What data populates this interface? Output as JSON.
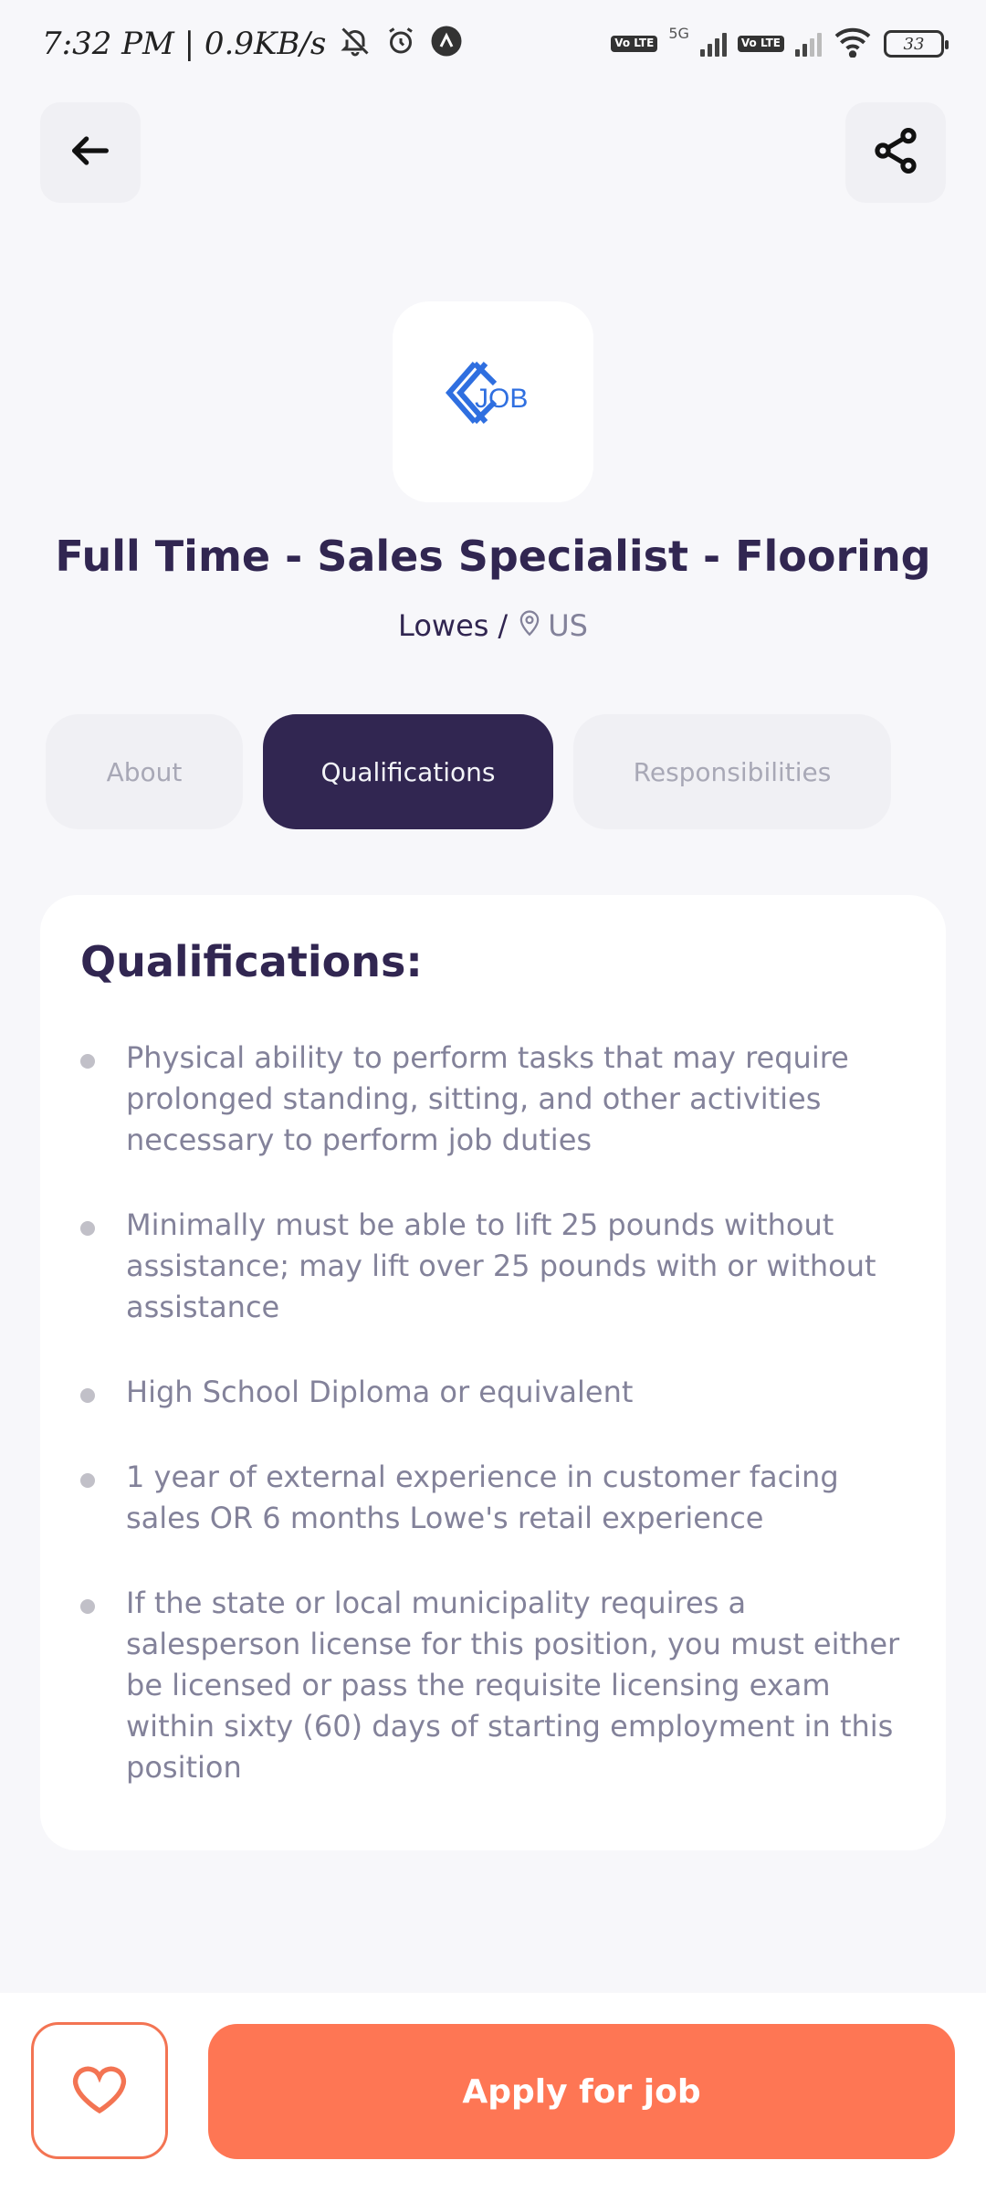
{
  "status_bar": {
    "time": "7:32 PM | 0.9KB/s",
    "volte_label": "Vo LTE",
    "network_label": "5G",
    "battery_level": "33"
  },
  "header": {
    "back_icon": "arrow-left-icon",
    "share_icon": "share-icon"
  },
  "job": {
    "logo_text": "JOB",
    "title": "Full Time - Sales Specialist - Flooring",
    "company": "Lowes",
    "separator": "/",
    "location": "US"
  },
  "tabs": [
    {
      "label": "About",
      "active": false
    },
    {
      "label": "Qualifications",
      "active": true
    },
    {
      "label": "Responsibilities",
      "active": false
    }
  ],
  "qualifications": {
    "heading": "Qualifications:",
    "items": [
      "Physical ability to perform tasks that may require prolonged standing, sitting, and other activities necessary to perform job duties",
      "Minimally must be able to lift 25 pounds without assistance; may lift over 25 pounds with or without assistance",
      "High School Diploma or equivalent",
      "1 year of external experience in customer facing sales OR 6 months Lowe's retail experience",
      "If the state or local municipality requires a salesperson license for this position, you must either be licensed or pass the requisite licensing exam within sixty (60) days of starting employment in this position"
    ]
  },
  "footer": {
    "favorite_icon": "heart-icon",
    "apply_label": "Apply for job"
  },
  "colors": {
    "primary": "#312651",
    "accent": "#FE7654",
    "muted_text": "#83829A",
    "logo_blue": "#2F6FE0"
  }
}
